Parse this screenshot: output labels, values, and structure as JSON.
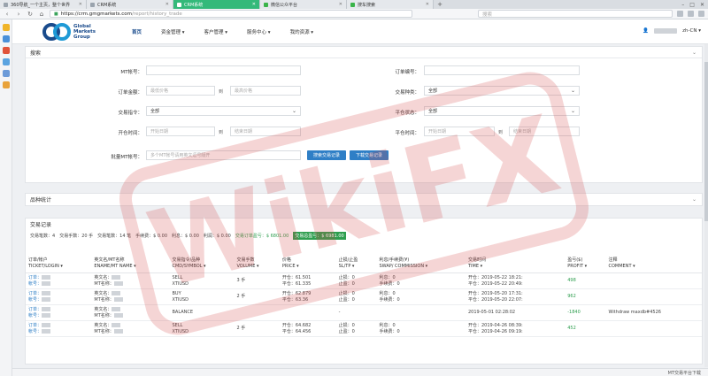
{
  "tabs": [
    {
      "label": "360导航_一个主页，整个世界",
      "active": false
    },
    {
      "label": "CRM系统",
      "active": false
    },
    {
      "label": "CRM系统",
      "active": true
    },
    {
      "label": "微信公众平台",
      "active": false
    },
    {
      "label": "搜车搜索",
      "active": false
    }
  ],
  "address": {
    "host": "https://crm.gmgmarkets.com",
    "path": "/report/history_trade",
    "search_placeholder": "搜索"
  },
  "logo": {
    "line1": "Global",
    "line2": "Markets",
    "line3": "Group"
  },
  "nav": [
    "首页",
    "资金管理 ▾",
    "客户管理 ▾",
    "服务中心 ▾",
    "我的资源 ▾"
  ],
  "lang": "zh-CN ▾",
  "search_panel": {
    "title": "搜索",
    "mt_account_label": "MT帐号：",
    "order_no_label": "订单编号：",
    "order_amount_label": "订单金额：",
    "min_price_ph": "最低价格",
    "to": "到",
    "max_price_ph": "最高价格",
    "symbol_label": "交易种类：",
    "all": "全部",
    "cmd_label": "交易指令：",
    "close_status_label": "平仓状态：",
    "open_time_label": "开仓时间：",
    "start_date_ph": "开始日期",
    "end_date_ph": "结束日期",
    "close_time_label": "平仓时间：",
    "batch_label": "批量MT帐号：",
    "batch_ph": "多个MT帐号请用英文逗号隔开",
    "search_btn": "搜索交易记录",
    "download_btn": "下载交易记录"
  },
  "stats_panel": {
    "title": "品种统计"
  },
  "records": {
    "title": "交易记录",
    "summary": [
      {
        "text": "交易笔数：4",
        "style": ""
      },
      {
        "text": "交易手数：20 手",
        "style": ""
      },
      {
        "text": "交易笔数：14 笔",
        "style": ""
      },
      {
        "text": "手续费：$ 0.00",
        "style": ""
      },
      {
        "text": "利息：$ 0.00",
        "style": ""
      },
      {
        "text": "利润：$ 0.00",
        "style": ""
      },
      {
        "text": "交易订单盈亏：$ 6801.00",
        "style": "gr"
      },
      {
        "text": "交易总盈亏：$ 6981.00",
        "style": "hl"
      }
    ],
    "headers": [
      [
        "订单/帐户",
        "TICKET/LOGIN ▾"
      ],
      [
        "英文名/MT名称",
        "ENAME/MT NAME ▾"
      ],
      [
        "交易指令/品种",
        "CMD/SYMBOL ▾"
      ],
      [
        "交易手数",
        "VOLUME ▾"
      ],
      [
        "价格",
        "PRICE ▾"
      ],
      [
        "止损/止盈",
        "SL/TP ▾"
      ],
      [
        "利息/手续费(¥)",
        "SWAP/ COMMISSION ▾"
      ],
      [
        "交易时间",
        "TIME ▾"
      ],
      [
        "盈亏($)",
        "PROFIT ▾"
      ],
      [
        "注释",
        "COMMENT ▾"
      ]
    ],
    "rows": [
      {
        "ticket": "订单：",
        "login": "帐号：",
        "ename": "英文名：",
        "mtname": "MT名称：",
        "cmd": "SELL",
        "symbol": "XTIUSD",
        "volume": "3 手",
        "open": "开仓：61.501",
        "close": "平仓：61.335",
        "sl": "止损：0",
        "tp": "止盈：0",
        "swap": "利息：0",
        "comm": "手续费：0",
        "t1": "开仓：2019-05-22 18:21:",
        "t2": "平仓：2019-05-22 20:49:",
        "profit": "498",
        "comment": ""
      },
      {
        "ticket": "订单：",
        "login": "帐号：",
        "ename": "英文名：",
        "mtname": "MT名称：",
        "cmd": "BUY",
        "symbol": "XTIUSD",
        "volume": "2 手",
        "open": "开仓：62.879",
        "close": "平仓：63.36",
        "sl": "止损：0",
        "tp": "止盈：0",
        "swap": "利息：0",
        "comm": "手续费：0",
        "t1": "开仓：2019-05-20 17:31:",
        "t2": "平仓：2019-05-20 22:07:",
        "profit": "962",
        "comment": ""
      },
      {
        "ticket": "订单：",
        "login": "帐号：",
        "ename": "英文名：",
        "mtname": "MT名称：",
        "cmd": "BALANCE",
        "symbol": "",
        "volume": "",
        "open": "",
        "close": "",
        "sl": "",
        "tp": "-",
        "swap": "",
        "comm": "",
        "t1": "2019-05-01 02:28:02",
        "t2": "",
        "profit": "-1840",
        "comment": "Withdraw maxdb#4526"
      },
      {
        "ticket": "订单：",
        "login": "帐号：",
        "ename": "英文名：",
        "mtname": "MT名称：",
        "cmd": "SELL",
        "symbol": "XTIUSD",
        "volume": "2 手",
        "open": "开仓：64.682",
        "close": "平仓：64.456",
        "sl": "止损：0",
        "tp": "止盈：0",
        "swap": "利息：0",
        "comm": "手续费：0",
        "t1": "开仓：2019-04-26 08:39:",
        "t2": "平仓：2019-04-26 09:19:",
        "profit": "452",
        "comment": ""
      }
    ]
  },
  "watermark": "WikiFX",
  "status_right": "MT交易平台下载",
  "colors": {
    "accent": "#2f7fc6",
    "tab_active": "#34b97a",
    "profit": "#2e9e4f",
    "brand": "#1a4b8c",
    "watermark": "#d64545"
  }
}
